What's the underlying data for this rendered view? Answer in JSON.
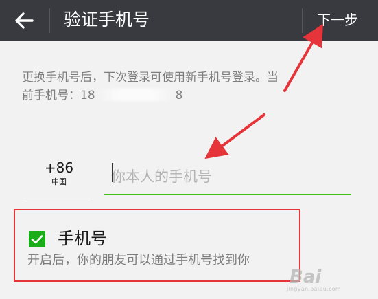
{
  "header": {
    "title": "验证手机号",
    "next_label": "下一步"
  },
  "hint": {
    "line1": "更换手机号后，下次登录可使用新手机号登录。当",
    "line2_prefix": "前手机号：18",
    "line2_suffix": "8"
  },
  "phone": {
    "country_code": "+86",
    "country_name": "中国",
    "placeholder": "你本人的手机号",
    "value": ""
  },
  "discoverable": {
    "checked": true,
    "label": "手机号",
    "description": "开启后，你的朋友可以通过手机号找到你"
  },
  "watermark": {
    "text": "Bai",
    "sub": "jingyan.baidu.com"
  },
  "colors": {
    "header_bg": "#393a3f",
    "accent_green": "#1aad19",
    "input_underline": "#45c01a",
    "annotation_red": "#e5343a"
  },
  "icons": {
    "back": "arrow-left-icon",
    "check": "checkmark-icon"
  }
}
